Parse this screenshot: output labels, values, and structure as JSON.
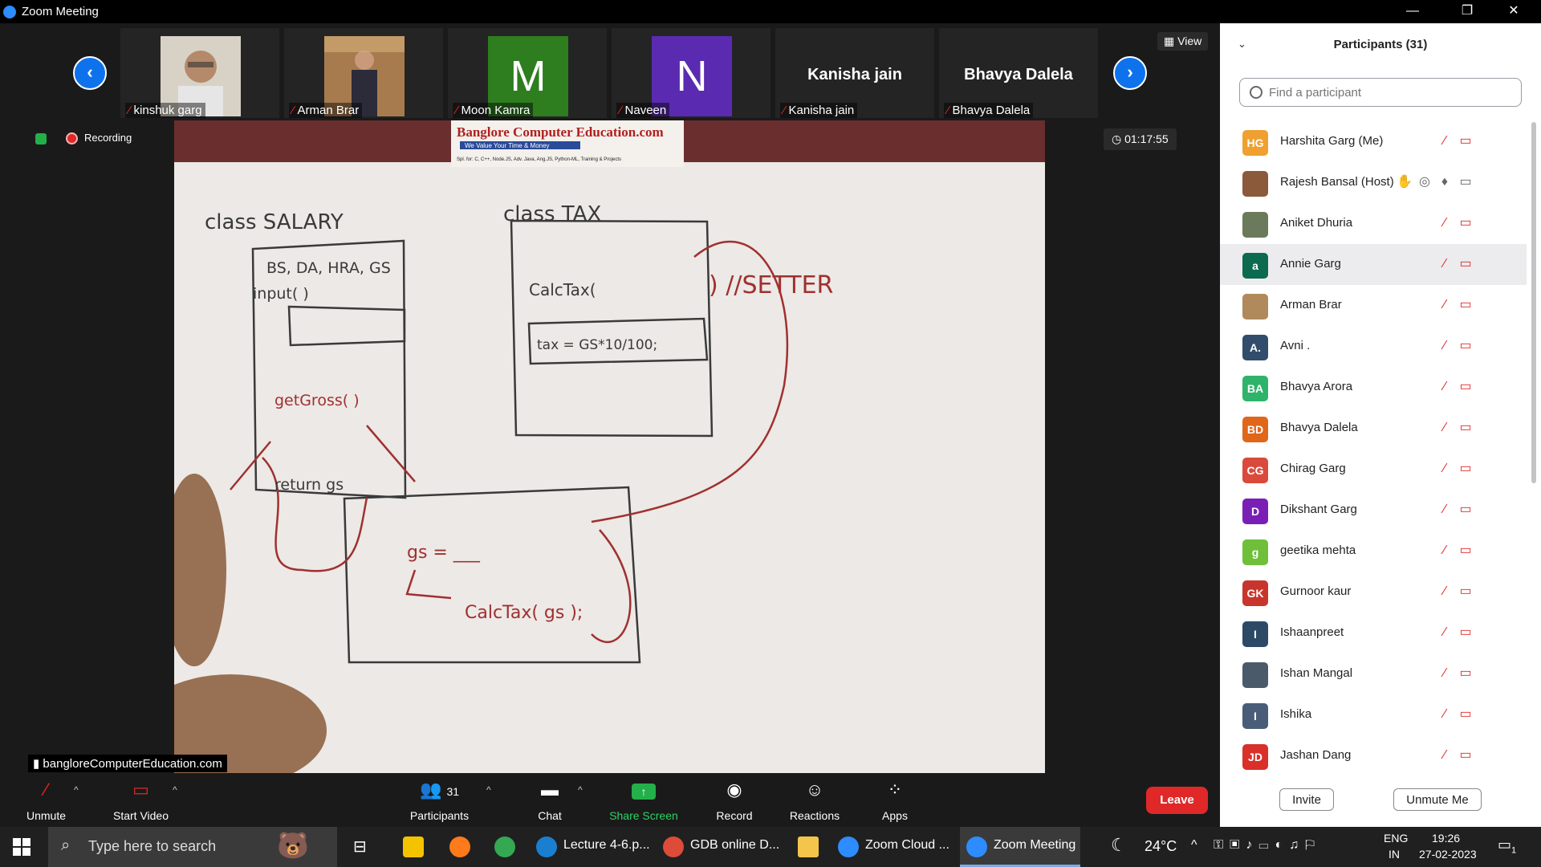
{
  "window": {
    "title": "Zoom Meeting",
    "minimize": "—",
    "restore": "❐",
    "close": "✕"
  },
  "gallery": {
    "view_label": "View",
    "thumbnails": [
      {
        "name": "kinshuk garg",
        "type": "photo"
      },
      {
        "name": "Arman Brar",
        "type": "photo"
      },
      {
        "name": "Moon Kamra",
        "type": "initial",
        "initial": "M",
        "color": "#2e7d1f"
      },
      {
        "name": "Naveen",
        "type": "initial",
        "initial": "N",
        "color": "#5a2bb0"
      },
      {
        "name": "Kanisha jain",
        "type": "text"
      },
      {
        "name": "Bhavya Dalela",
        "type": "text"
      }
    ],
    "prev_icon": "chevron-left-icon",
    "next_icon": "chevron-right-icon"
  },
  "meeting": {
    "recording_label": "Recording",
    "timer": "01:17:55",
    "source_label": "bangloreComputerEducation.com"
  },
  "whiteboard": {
    "banner_title": "Banglore Computer Education.com",
    "banner_sub": "We Value Your Time & Money",
    "banner_small": "Spl. for: C, C++, Node.JS, Adv. Java, Ang.JS, Python-ML, Training & Projects",
    "class_salary": "class SALARY",
    "salary_fields": "BS, DA, HRA, GS",
    "input_fn": "input( )",
    "calc_tax_fn": "CalcTax(",
    "setter_note": ") //SETTER",
    "class_tax": "class TAX",
    "tax_formula": "tax = GS*10/100;",
    "getgross": "getGross( )",
    "return_gs": "return gs",
    "gs_eq": "gs = ___",
    "calc_tax_gs": "CalcTax( gs );"
  },
  "toolbar": {
    "unmute": "Unmute",
    "start_video": "Start Video",
    "participants": "Participants",
    "participants_count": "31",
    "chat": "Chat",
    "share_screen": "Share Screen",
    "record": "Record",
    "reactions": "Reactions",
    "apps": "Apps",
    "leave": "Leave"
  },
  "panel": {
    "header": "Participants (31)",
    "search_placeholder": "Find a participant",
    "invite": "Invite",
    "unmute_me": "Unmute Me",
    "participants": [
      {
        "name": "Harshita Garg (Me)",
        "initials": "HG",
        "color": "#f0a030"
      },
      {
        "name": "Rajesh Bansal (Host)",
        "initials": "",
        "color": "#8a5a3a",
        "host": true
      },
      {
        "name": "Aniket Dhuria",
        "initials": "",
        "color": "#6a7a5a"
      },
      {
        "name": "Annie Garg",
        "initials": "a",
        "color": "#0c6b4f",
        "highlight": true
      },
      {
        "name": "Arman Brar",
        "initials": "",
        "color": "#b08a5a"
      },
      {
        "name": "Avni .",
        "initials": "A.",
        "color": "#314d6b"
      },
      {
        "name": "Bhavya Arora",
        "initials": "BA",
        "color": "#2fb36a"
      },
      {
        "name": "Bhavya Dalela",
        "initials": "BD",
        "color": "#e0661a"
      },
      {
        "name": "Chirag Garg",
        "initials": "CG",
        "color": "#d94a3c"
      },
      {
        "name": "Dikshant Garg",
        "initials": "D",
        "color": "#7a1fb5"
      },
      {
        "name": "geetika mehta",
        "initials": "g",
        "color": "#6fbf3a"
      },
      {
        "name": "Gurnoor kaur",
        "initials": "GK",
        "color": "#c8352c"
      },
      {
        "name": "Ishaanpreet",
        "initials": "I",
        "color": "#2c4a66"
      },
      {
        "name": "Ishan Mangal",
        "initials": "",
        "color": "#4a5a6a"
      },
      {
        "name": "Ishika",
        "initials": "I",
        "color": "#4a5d78"
      },
      {
        "name": "Jashan Dang",
        "initials": "JD",
        "color": "#d9302a"
      }
    ]
  },
  "taskbar": {
    "search_placeholder": "Type here to search",
    "apps": [
      {
        "label": "Lecture 4-6.p...",
        "color": "#1b7fd1"
      },
      {
        "label": "GDB online D...",
        "color": "#dd4b39"
      },
      {
        "label": "Zoom Cloud ...",
        "color": "#2d8cff"
      },
      {
        "label": "Zoom Meeting",
        "color": "#2d8cff"
      }
    ],
    "temperature": "24°C",
    "lang_top": "ENG",
    "lang_bottom": "IN",
    "time": "19:26",
    "date": "27-02-2023",
    "notification_count": "1"
  }
}
